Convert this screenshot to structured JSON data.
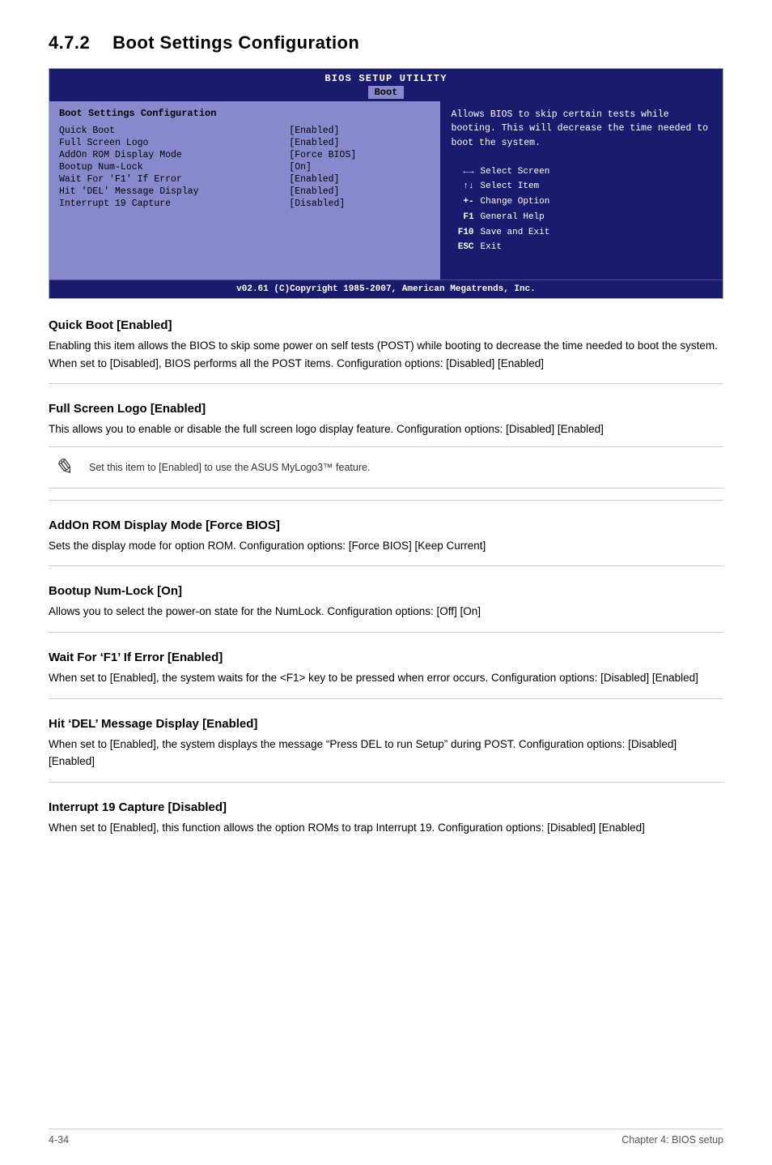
{
  "page": {
    "section_number": "4.7.2",
    "section_title": "Boot Settings Configuration"
  },
  "bios": {
    "header": "BIOS SETUP UTILITY",
    "active_tab": "Boot",
    "left_panel_title": "Boot Settings Configuration",
    "items": [
      {
        "label": "Quick Boot",
        "value": "[Enabled]"
      },
      {
        "label": "Full Screen Logo",
        "value": "[Enabled]"
      },
      {
        "label": "AddOn ROM Display Mode",
        "value": "[Force BIOS]"
      },
      {
        "label": "Bootup Num-Lock",
        "value": "[On]"
      },
      {
        "label": "Wait For 'F1' If Error",
        "value": "[Enabled]"
      },
      {
        "label": "Hit 'DEL' Message Display",
        "value": "[Enabled]"
      },
      {
        "label": "Interrupt 19 Capture",
        "value": "[Disabled]"
      }
    ],
    "help_text": "Allows BIOS to skip certain tests while booting. This will decrease the time needed to boot the system.",
    "keys": [
      {
        "symbol": "←→",
        "desc": "Select Screen"
      },
      {
        "symbol": "↑↓",
        "desc": "Select Item"
      },
      {
        "symbol": "+-",
        "desc": "Change Option"
      },
      {
        "symbol": "F1",
        "desc": "General Help"
      },
      {
        "symbol": "F10",
        "desc": "Save and Exit"
      },
      {
        "symbol": "ESC",
        "desc": "Exit"
      }
    ],
    "footer": "v02.61 (C)Copyright 1985-2007, American Megatrends, Inc."
  },
  "subsections": [
    {
      "id": "quick-boot",
      "heading": "Quick Boot [Enabled]",
      "body": "Enabling this item allows the BIOS to skip some power on self tests (POST) while booting to decrease the time needed to boot the system. When set to [Disabled], BIOS performs all the POST items. Configuration options: [Disabled] [Enabled]"
    },
    {
      "id": "full-screen-logo",
      "heading": "Full Screen Logo [Enabled]",
      "body": "This allows you to enable or disable the full screen logo display feature. Configuration options: [Disabled] [Enabled]",
      "note": "Set this item to [Enabled] to use the ASUS MyLogo3™ feature."
    },
    {
      "id": "addon-rom",
      "heading": "AddOn ROM Display Mode [Force BIOS]",
      "body": "Sets the display mode for option ROM. Configuration options: [Force BIOS] [Keep Current]"
    },
    {
      "id": "bootup-numlock",
      "heading": "Bootup Num-Lock [On]",
      "body": "Allows you to select the power-on state for the NumLock. Configuration options: [Off] [On]"
    },
    {
      "id": "wait-f1",
      "heading": "Wait For ‘F1’ If Error [Enabled]",
      "body": "When set to [Enabled], the system waits for the <F1> key to be pressed when error occurs. Configuration options: [Disabled] [Enabled]"
    },
    {
      "id": "hit-del",
      "heading": "Hit ‘DEL’ Message Display [Enabled]",
      "body": "When set to [Enabled], the system displays the message “Press DEL to run Setup” during POST. Configuration options: [Disabled] [Enabled]"
    },
    {
      "id": "interrupt-19",
      "heading": "Interrupt 19 Capture [Disabled]",
      "body": "When set to [Enabled], this function allows the option ROMs to trap Interrupt 19. Configuration options: [Disabled] [Enabled]"
    }
  ],
  "footer": {
    "left": "4-34",
    "right": "Chapter 4: BIOS setup"
  }
}
